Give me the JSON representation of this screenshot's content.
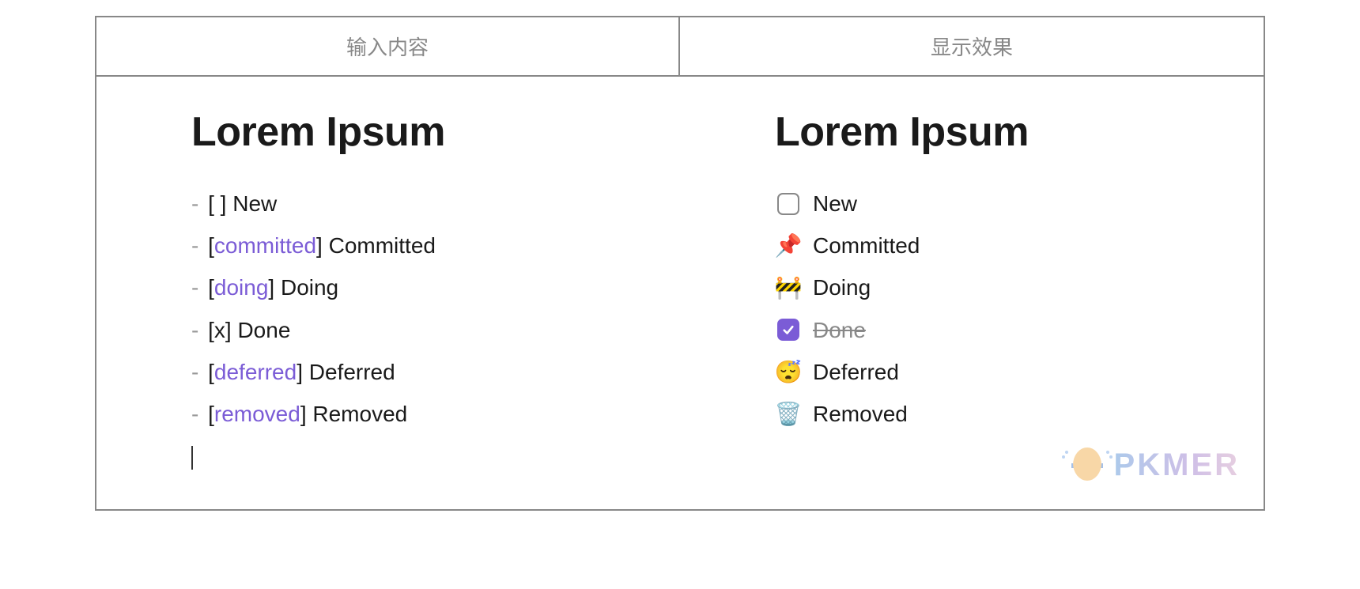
{
  "headers": {
    "input": "输入内容",
    "output": "显示效果"
  },
  "heading": "Lorem Ipsum",
  "source_items": [
    {
      "prefix": "[ ]",
      "status": "",
      "label": "New"
    },
    {
      "prefix": "[",
      "status": "committed",
      "suffix": "]",
      "label": "Committed"
    },
    {
      "prefix": "[",
      "status": "doing",
      "suffix": "]",
      "label": "Doing"
    },
    {
      "prefix": "[x]",
      "status": "",
      "label": "Done"
    },
    {
      "prefix": "[",
      "status": "deferred",
      "suffix": "]",
      "label": "Deferred"
    },
    {
      "prefix": "[",
      "status": "removed",
      "suffix": "]",
      "label": "Removed"
    }
  ],
  "rendered_items": [
    {
      "icon": "empty-checkbox",
      "label": "New",
      "strike": false
    },
    {
      "icon": "pushpin",
      "label": "Committed",
      "strike": false
    },
    {
      "icon": "construction",
      "label": "Doing",
      "strike": false
    },
    {
      "icon": "checked-checkbox",
      "label": "Done",
      "strike": true
    },
    {
      "icon": "sleeping",
      "label": "Deferred",
      "strike": false
    },
    {
      "icon": "wastebasket",
      "label": "Removed",
      "strike": false
    }
  ],
  "watermark": "PKMER",
  "emoji_map": {
    "pushpin": "📌",
    "construction": "🚧",
    "sleeping": "😴",
    "wastebasket": "🗑️"
  }
}
